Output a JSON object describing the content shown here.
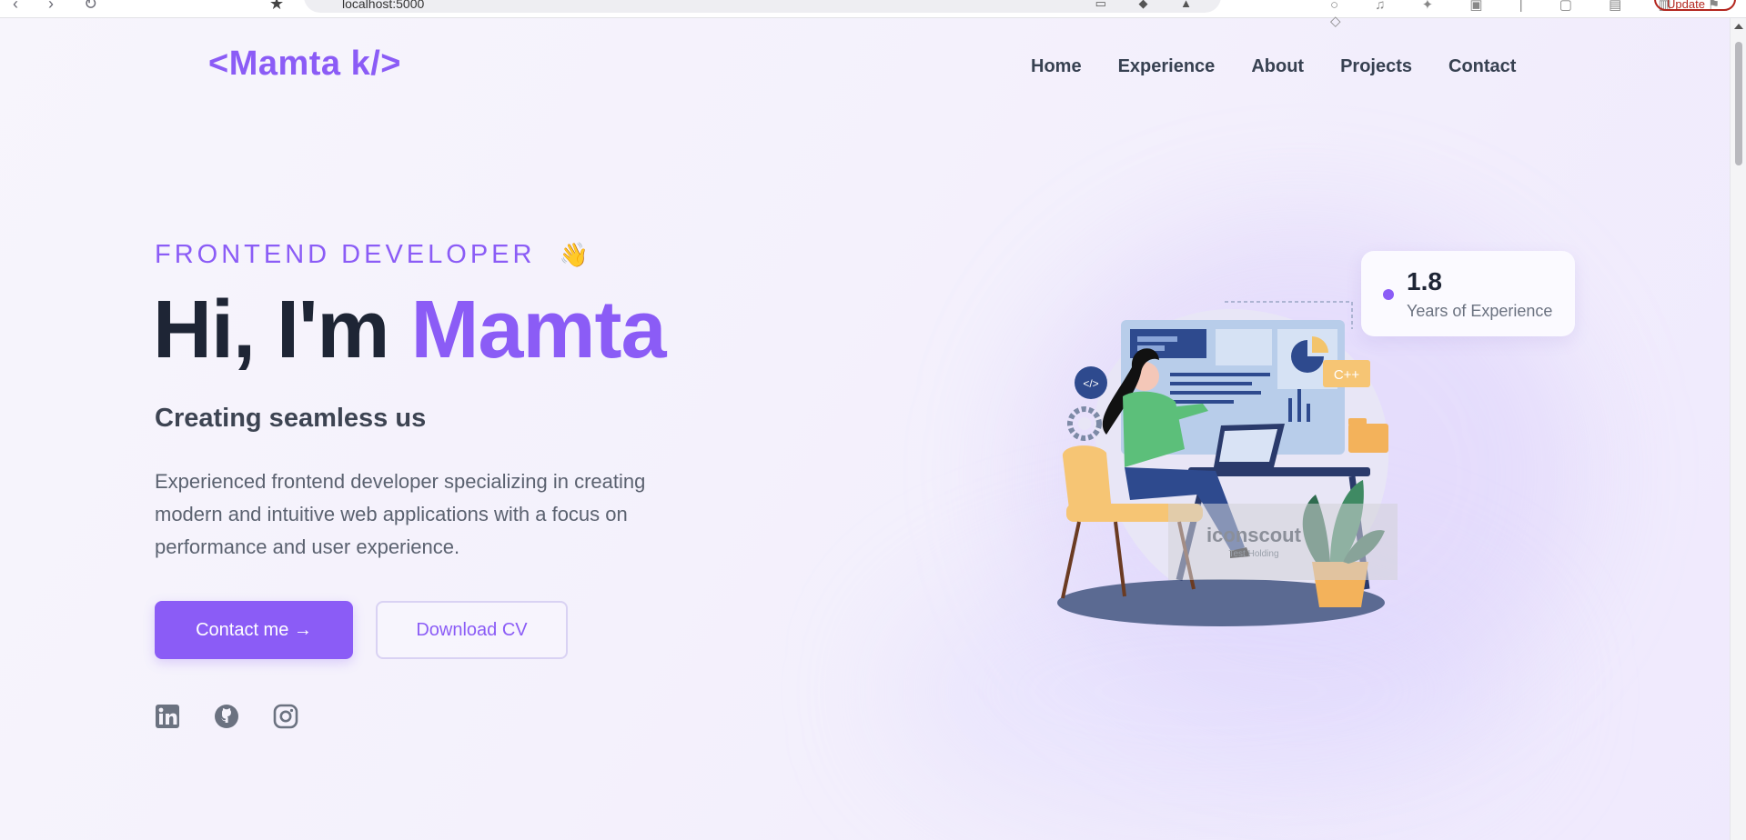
{
  "browser": {
    "url": "localhost:5000",
    "update_label": "Update"
  },
  "colors": {
    "accent": "#8b5cf6",
    "heading": "#1e2535",
    "text": "#5b6270"
  },
  "header": {
    "logo": "<Mamta k/>",
    "nav": [
      {
        "label": "Home"
      },
      {
        "label": "Experience"
      },
      {
        "label": "About"
      },
      {
        "label": "Projects"
      },
      {
        "label": "Contact"
      }
    ]
  },
  "hero": {
    "eyebrow": "FRONTEND DEVELOPER",
    "eyebrow_emoji": "👋",
    "title_prefix": "Hi, I'm ",
    "title_name": "Mamta",
    "subtitle": "Creating seamless us",
    "description": "Experienced frontend developer specializing in creating modern and intuitive web applications with a focus on performance and user experience.",
    "primary_button": "Contact me →",
    "secondary_button": "Download CV",
    "socials": [
      {
        "name": "linkedin-icon"
      },
      {
        "name": "github-icon"
      },
      {
        "name": "instagram-icon"
      }
    ]
  },
  "stat": {
    "value": "1.8",
    "label": "Years of Experience"
  },
  "illustration": {
    "code_badge": "</>",
    "language_tag": "C++",
    "watermark": "iconscout",
    "watermark_sub": "Test Holding"
  }
}
